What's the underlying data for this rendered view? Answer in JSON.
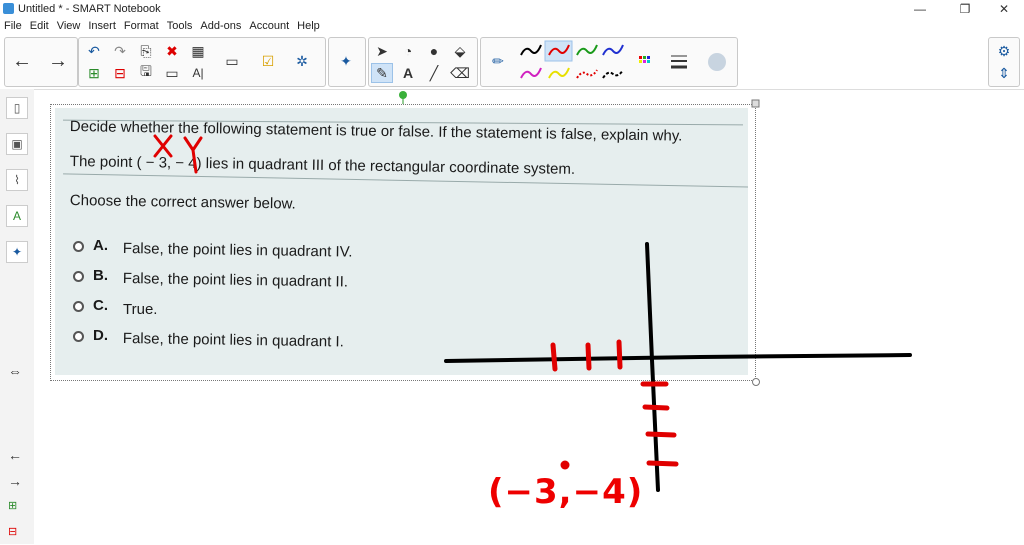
{
  "window": {
    "title": "Untitled * - SMART Notebook"
  },
  "menu": [
    "File",
    "Edit",
    "View",
    "Insert",
    "Format",
    "Tools",
    "Add-ons",
    "Account",
    "Help"
  ],
  "question": {
    "line1": "Decide whether the following statement is true or false. If the statement is false, explain why.",
    "line2": "The point ( − 3, − 4) lies in quadrant III of the rectangular coordinate system.",
    "prompt": "Choose the correct answer below.",
    "options": [
      {
        "letter": "A.",
        "text": "False, the point lies in quadrant IV."
      },
      {
        "letter": "B.",
        "text": "False, the point lies in quadrant II."
      },
      {
        "letter": "C.",
        "text": "True."
      },
      {
        "letter": "D.",
        "text": "False, the point lies in quadrant I."
      }
    ]
  },
  "annotations": {
    "x_label": "X",
    "y_label": "Y",
    "point_label": "(−3,−4)"
  },
  "colors": {
    "ink_red": "#e00000",
    "ink_black": "#000000",
    "accent": "#3a8fd8"
  }
}
